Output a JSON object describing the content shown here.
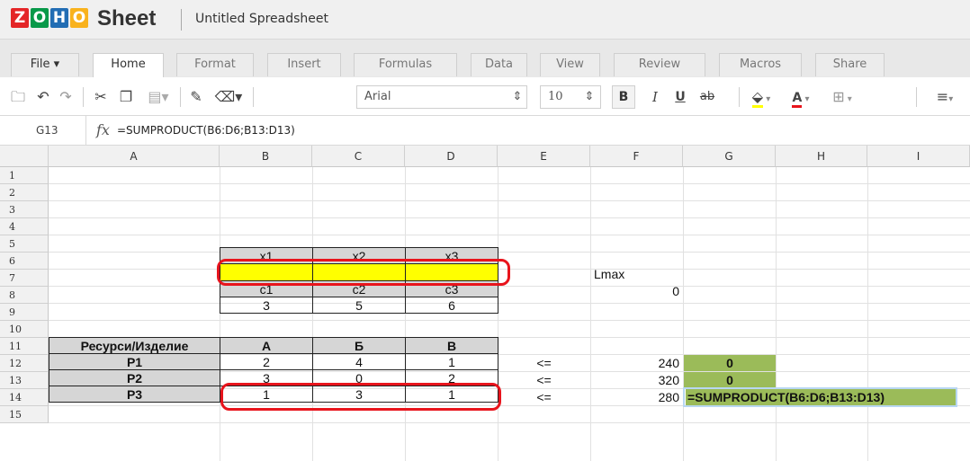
{
  "app": {
    "logo_letters": [
      "Z",
      "O",
      "H",
      "O"
    ],
    "logo_colors": [
      "#e42527",
      "#089949",
      "#226db4",
      "#f9b21d"
    ],
    "name": "Sheet",
    "doc_title": "Untitled Spreadsheet"
  },
  "tabs": [
    {
      "label": "File ▾"
    },
    {
      "label": "Home"
    },
    {
      "label": "Format"
    },
    {
      "label": "Insert"
    },
    {
      "label": "Formulas"
    },
    {
      "label": "Data"
    },
    {
      "label": "View"
    },
    {
      "label": "Review"
    },
    {
      "label": "Macros"
    },
    {
      "label": "Share"
    }
  ],
  "active_tab": "Home",
  "toolbar": {
    "font_name": "Arial",
    "font_size": "10",
    "bold_label": "B",
    "italic_label": "I",
    "underline_label": "U",
    "strike_label": "ab",
    "font_color_label": "A"
  },
  "formula_bar": {
    "cell_ref": "G13",
    "fx_label": "fx",
    "formula": "=SUMPRODUCT(B6:D6;B13:D13)"
  },
  "grid": {
    "columns": [
      "A",
      "B",
      "C",
      "D",
      "E",
      "F",
      "G",
      "H",
      "I"
    ],
    "rows": [
      "1",
      "2",
      "3",
      "4",
      "5",
      "6",
      "7",
      "8",
      "9",
      "10",
      "11",
      "12",
      "13",
      "14",
      "15"
    ],
    "cells": {
      "B5": "x1",
      "C5": "x2",
      "D5": "x3",
      "F6": "Lmax",
      "B7": "c1",
      "C7": "c2",
      "D7": "c3",
      "F7": "0",
      "B8": "3",
      "C8": "5",
      "D8": "6",
      "A10": "Ресурси/Изделие",
      "B10": "А",
      "C10": "Б",
      "D10": "В",
      "A11": "Р1",
      "B11": "2",
      "C11": "4",
      "D11": "1",
      "E11": "<=",
      "F11": "240",
      "G11": "0",
      "A12": "Р2",
      "B12": "3",
      "C12": "0",
      "D12": "2",
      "E12": "<=",
      "F12": "320",
      "G12": "0",
      "A13": "Р3",
      "B13": "1",
      "C13": "3",
      "D13": "1",
      "E13": "<=",
      "F13": "280",
      "G13": "=SUMPRODUCT(B6:D6;B13:D13)"
    }
  },
  "colors": {
    "header_gray": "#d6d6d6",
    "variable_yellow": "#ffff00",
    "result_green": "#9bbb59",
    "highlight_red": "#e8141c"
  }
}
